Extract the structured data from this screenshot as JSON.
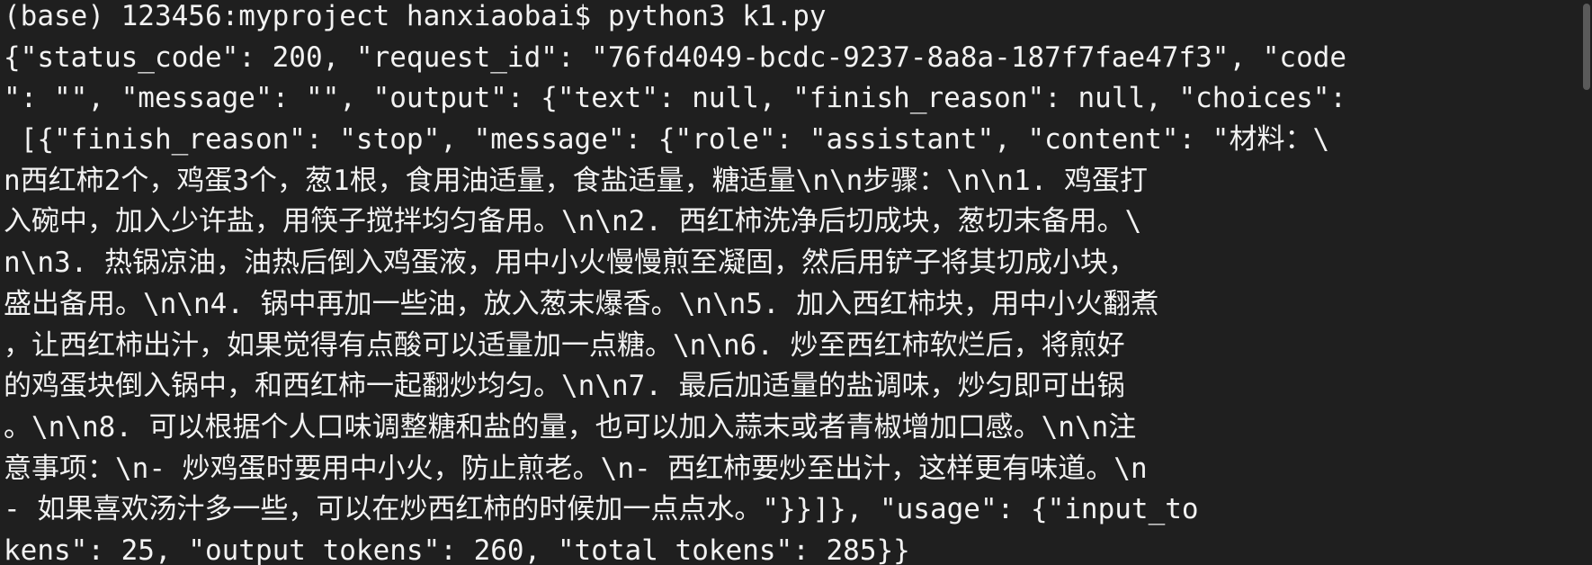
{
  "terminal": {
    "prompt_line": "(base) 123456:myproject hanxiaobai$ python3 k1.py",
    "output_lines": [
      "{\"status_code\": 200, \"request_id\": \"76fd4049-bcdc-9237-8a8a-187f7fae47f3\", \"code",
      "\": \"\", \"message\": \"\", \"output\": {\"text\": null, \"finish_reason\": null, \"choices\":",
      " [{\"finish_reason\": \"stop\", \"message\": {\"role\": \"assistant\", \"content\": \"材料：\\",
      "n西红柿2个，鸡蛋3个，葱1根，食用油适量，食盐适量，糖适量\\n\\n步骤：\\n\\n1. 鸡蛋打",
      "入碗中，加入少许盐，用筷子搅拌均匀备用。\\n\\n2. 西红柿洗净后切成块，葱切末备用。\\",
      "n\\n3. 热锅凉油，油热后倒入鸡蛋液，用中小火慢慢煎至凝固，然后用铲子将其切成小块，",
      "盛出备用。\\n\\n4. 锅中再加一些油，放入葱末爆香。\\n\\n5. 加入西红柿块，用中小火翻煮",
      "，让西红柿出汁，如果觉得有点酸可以适量加一点糖。\\n\\n6. 炒至西红柿软烂后，将煎好",
      "的鸡蛋块倒入锅中，和西红柿一起翻炒均匀。\\n\\n7. 最后加适量的盐调味，炒匀即可出锅",
      "。\\n\\n8. 可以根据个人口味调整糖和盐的量，也可以加入蒜末或者青椒增加口感。\\n\\n注",
      "意事项：\\n- 炒鸡蛋时要用中小火，防止煎老。\\n- 西红柿要炒至出汁，这样更有味道。\\n",
      "- 如果喜欢汤汁多一些，可以在炒西红柿的时候加一点点水。\"}}]}, \"usage\": {\"input_to",
      "kens\": 25, \"output_tokens\": 260, \"total_tokens\": 285}}"
    ]
  },
  "colors": {
    "background": "#1f1f1f",
    "foreground": "#f2f2f2"
  }
}
